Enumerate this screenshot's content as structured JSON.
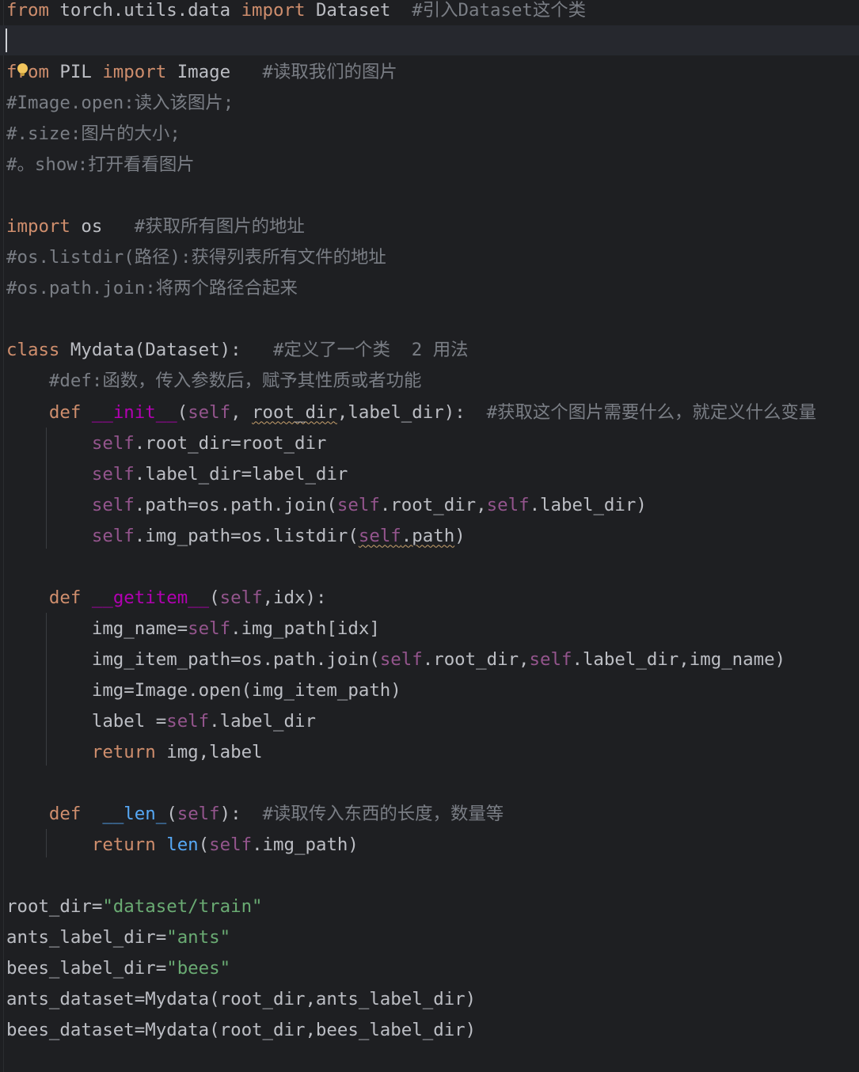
{
  "editor": {
    "lines": [
      [
        {
          "t": "from",
          "c": "kw"
        },
        {
          "t": " torch.utils.data ",
          "c": ""
        },
        {
          "t": "import",
          "c": "kw"
        },
        {
          "t": " Dataset  ",
          "c": ""
        },
        {
          "t": "#引入Dataset这个类",
          "c": "cm"
        }
      ],
      [],
      [
        {
          "t": "from",
          "c": "kw"
        },
        {
          "t": " PIL ",
          "c": ""
        },
        {
          "t": "import",
          "c": "kw"
        },
        {
          "t": " Image   ",
          "c": ""
        },
        {
          "t": "#读取我们的图片",
          "c": "cm"
        }
      ],
      [
        {
          "t": "#Image.open:读入该图片;",
          "c": "cm"
        }
      ],
      [
        {
          "t": "#.size:图片的大小;",
          "c": "cm"
        }
      ],
      [
        {
          "t": "#。show:打开看看图片",
          "c": "cm"
        }
      ],
      [],
      [
        {
          "t": "import",
          "c": "kw"
        },
        {
          "t": " os   ",
          "c": ""
        },
        {
          "t": "#获取所有图片的地址",
          "c": "cm"
        }
      ],
      [
        {
          "t": "#os.listdir(路径):获得列表所有文件的地址",
          "c": "cm"
        }
      ],
      [
        {
          "t": "#os.path.join:将两个路径合起来",
          "c": "cm"
        }
      ],
      [],
      [
        {
          "t": "class",
          "c": "kw"
        },
        {
          "t": " Mydata(Dataset):   ",
          "c": ""
        },
        {
          "t": "#定义了一个类  2 用法",
          "c": "cm"
        }
      ],
      [
        {
          "t": "    ",
          "c": ""
        },
        {
          "t": "#def:函数，传入参数后，赋予其性质或者功能",
          "c": "cm"
        }
      ],
      [
        {
          "t": "    ",
          "c": ""
        },
        {
          "t": "def",
          "c": "kw"
        },
        {
          "t": " ",
          "c": ""
        },
        {
          "t": "__init__",
          "c": "dn"
        },
        {
          "t": "(",
          "c": ""
        },
        {
          "t": "self",
          "c": "sf"
        },
        {
          "t": ", ",
          "c": ""
        },
        {
          "t": "root_dir",
          "c": "wavy"
        },
        {
          "t": ",label_dir):  ",
          "c": ""
        },
        {
          "t": "#获取这个图片需要什么，就定义什么变量",
          "c": "cm"
        }
      ],
      [
        {
          "t": "        ",
          "c": ""
        },
        {
          "t": "self",
          "c": "sf"
        },
        {
          "t": ".root_dir=root_dir",
          "c": ""
        }
      ],
      [
        {
          "t": "        ",
          "c": ""
        },
        {
          "t": "self",
          "c": "sf"
        },
        {
          "t": ".label_dir=label_dir",
          "c": ""
        }
      ],
      [
        {
          "t": "        ",
          "c": ""
        },
        {
          "t": "self",
          "c": "sf"
        },
        {
          "t": ".path=os.path.join(",
          "c": ""
        },
        {
          "t": "self",
          "c": "sf"
        },
        {
          "t": ".root_dir,",
          "c": ""
        },
        {
          "t": "self",
          "c": "sf"
        },
        {
          "t": ".label_dir)",
          "c": ""
        }
      ],
      [
        {
          "t": "        ",
          "c": ""
        },
        {
          "t": "self",
          "c": "sf"
        },
        {
          "t": ".img_path=os.listdir(",
          "c": ""
        },
        {
          "t": "self",
          "c": "sf wavy"
        },
        {
          "t": ".path",
          "c": "wavy"
        },
        {
          "t": ")",
          "c": ""
        }
      ],
      [],
      [
        {
          "t": "    ",
          "c": ""
        },
        {
          "t": "def",
          "c": "kw"
        },
        {
          "t": " ",
          "c": ""
        },
        {
          "t": "__getitem__",
          "c": "dn"
        },
        {
          "t": "(",
          "c": ""
        },
        {
          "t": "self",
          "c": "sf"
        },
        {
          "t": ",idx):",
          "c": ""
        }
      ],
      [
        {
          "t": "        img_name=",
          "c": ""
        },
        {
          "t": "self",
          "c": "sf"
        },
        {
          "t": ".img_path[idx]",
          "c": ""
        }
      ],
      [
        {
          "t": "        img_item_path=os.path.join(",
          "c": ""
        },
        {
          "t": "self",
          "c": "sf"
        },
        {
          "t": ".root_dir,",
          "c": ""
        },
        {
          "t": "self",
          "c": "sf"
        },
        {
          "t": ".label_dir,img_name)",
          "c": ""
        }
      ],
      [
        {
          "t": "        img=Image.open(img_item_path)",
          "c": ""
        }
      ],
      [
        {
          "t": "        label =",
          "c": ""
        },
        {
          "t": "self",
          "c": "sf"
        },
        {
          "t": ".label_dir",
          "c": ""
        }
      ],
      [
        {
          "t": "        ",
          "c": ""
        },
        {
          "t": "return",
          "c": "kw"
        },
        {
          "t": " img,label",
          "c": ""
        }
      ],
      [],
      [
        {
          "t": "    ",
          "c": ""
        },
        {
          "t": "def",
          "c": "kw"
        },
        {
          "t": "  ",
          "c": ""
        },
        {
          "t": "__len_",
          "c": "bi"
        },
        {
          "t": "(",
          "c": ""
        },
        {
          "t": "self",
          "c": "sf"
        },
        {
          "t": "):  ",
          "c": ""
        },
        {
          "t": "#读取传入东西的长度，数量等",
          "c": "cm"
        }
      ],
      [
        {
          "t": "        ",
          "c": ""
        },
        {
          "t": "return",
          "c": "kw"
        },
        {
          "t": " ",
          "c": ""
        },
        {
          "t": "len",
          "c": "bi"
        },
        {
          "t": "(",
          "c": ""
        },
        {
          "t": "self",
          "c": "sf"
        },
        {
          "t": ".img_path)",
          "c": ""
        }
      ],
      [],
      [
        {
          "t": "root_dir=",
          "c": ""
        },
        {
          "t": "\"dataset/train\"",
          "c": "st"
        }
      ],
      [
        {
          "t": "ants_label_dir=",
          "c": ""
        },
        {
          "t": "\"ants\"",
          "c": "st"
        }
      ],
      [
        {
          "t": "bees_label_dir=",
          "c": ""
        },
        {
          "t": "\"bees\"",
          "c": "st"
        }
      ],
      [
        {
          "t": "ants_dataset=Mydata(root_dir,ants_label_dir)",
          "c": ""
        }
      ],
      [
        {
          "t": "bees_dataset=Mydata(root_dir,bees_label_dir)",
          "c": ""
        }
      ]
    ]
  }
}
